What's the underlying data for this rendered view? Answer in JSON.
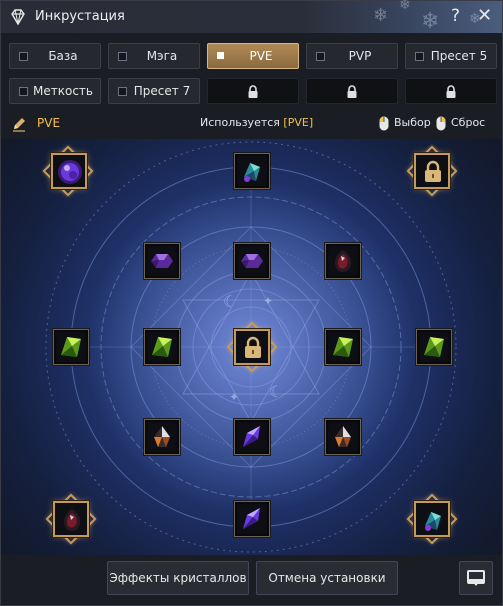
{
  "window": {
    "title": "Инкрустация",
    "help_label": "?",
    "close_label": "✕"
  },
  "presets": {
    "row1": [
      {
        "label": "База",
        "active": false
      },
      {
        "label": "Мэга",
        "active": false
      },
      {
        "label": "PVE",
        "active": true
      },
      {
        "label": "PVP",
        "active": false
      },
      {
        "label": "Пресет 5",
        "active": false
      }
    ],
    "row2": [
      {
        "label": "Меткость",
        "active": false
      },
      {
        "label": "Пресет 7",
        "active": false
      },
      {
        "label": "",
        "locked": true
      },
      {
        "label": "",
        "locked": true
      },
      {
        "label": "",
        "locked": true
      }
    ]
  },
  "info": {
    "preset_name": "PVE",
    "in_use_prefix": "Используется ",
    "in_use_value": "[PVE]",
    "select_hint": "Выбор",
    "reset_hint": "Сброс"
  },
  "slots": [
    {
      "name": "slot-top-left",
      "gem": "purple-sphere"
    },
    {
      "name": "slot-top-center",
      "gem": "teal-crystal"
    },
    {
      "name": "slot-top-right",
      "gem": "locked"
    },
    {
      "name": "slot-r2-left",
      "gem": "purple-ore"
    },
    {
      "name": "slot-r2-center",
      "gem": "purple-ore"
    },
    {
      "name": "slot-r2-right",
      "gem": "dark-red-stone"
    },
    {
      "name": "slot-mid-far-left",
      "gem": "green-crystal"
    },
    {
      "name": "slot-mid-left",
      "gem": "green-crystal"
    },
    {
      "name": "slot-center",
      "gem": "locked"
    },
    {
      "name": "slot-mid-right",
      "gem": "green-crystal"
    },
    {
      "name": "slot-mid-far-right",
      "gem": "green-crystal"
    },
    {
      "name": "slot-r4-left",
      "gem": "orange-shard"
    },
    {
      "name": "slot-r4-center",
      "gem": "violet-shard"
    },
    {
      "name": "slot-r4-right",
      "gem": "orange-shard"
    },
    {
      "name": "slot-bottom-left",
      "gem": "dark-red-stone"
    },
    {
      "name": "slot-bottom-center",
      "gem": "violet-shard"
    },
    {
      "name": "slot-bottom-right",
      "gem": "teal-crystal"
    }
  ],
  "actions": {
    "effects_label": "Эффекты кристаллов",
    "cancel_label": "Отмена установки"
  },
  "colors": {
    "accent_gold": "#f2c14a",
    "active_preset": "#b08a55",
    "board_glow": "#4a63b5"
  }
}
